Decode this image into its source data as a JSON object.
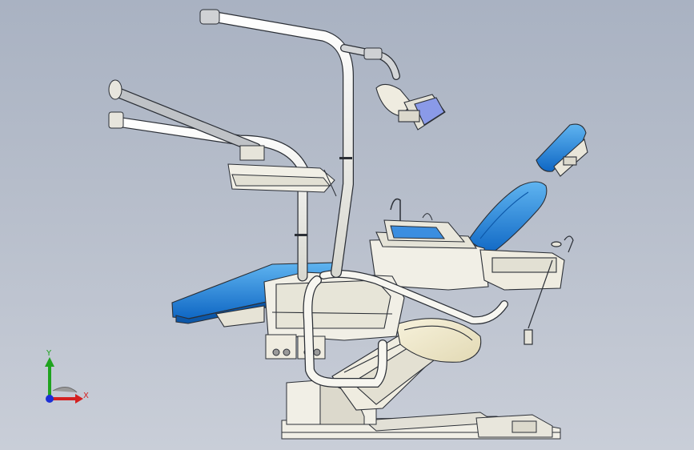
{
  "viewport": {
    "background_top": "#a9b2c2",
    "background_bottom": "#c9ced8"
  },
  "model": {
    "colors": {
      "outline": "#2b2f36",
      "body": "#f1efe6",
      "body_shade": "#dcd9cc",
      "upholstery": "#1a7fd8",
      "upholstery_light": "#5fb4f0",
      "metal": "#c7c9cc",
      "cream": "#efe9cf"
    }
  },
  "triad": {
    "x_label": "X",
    "y_label": "Y",
    "x_color": "#d42020",
    "y_color": "#1fa31f",
    "z_color": "#1c2fd6"
  }
}
